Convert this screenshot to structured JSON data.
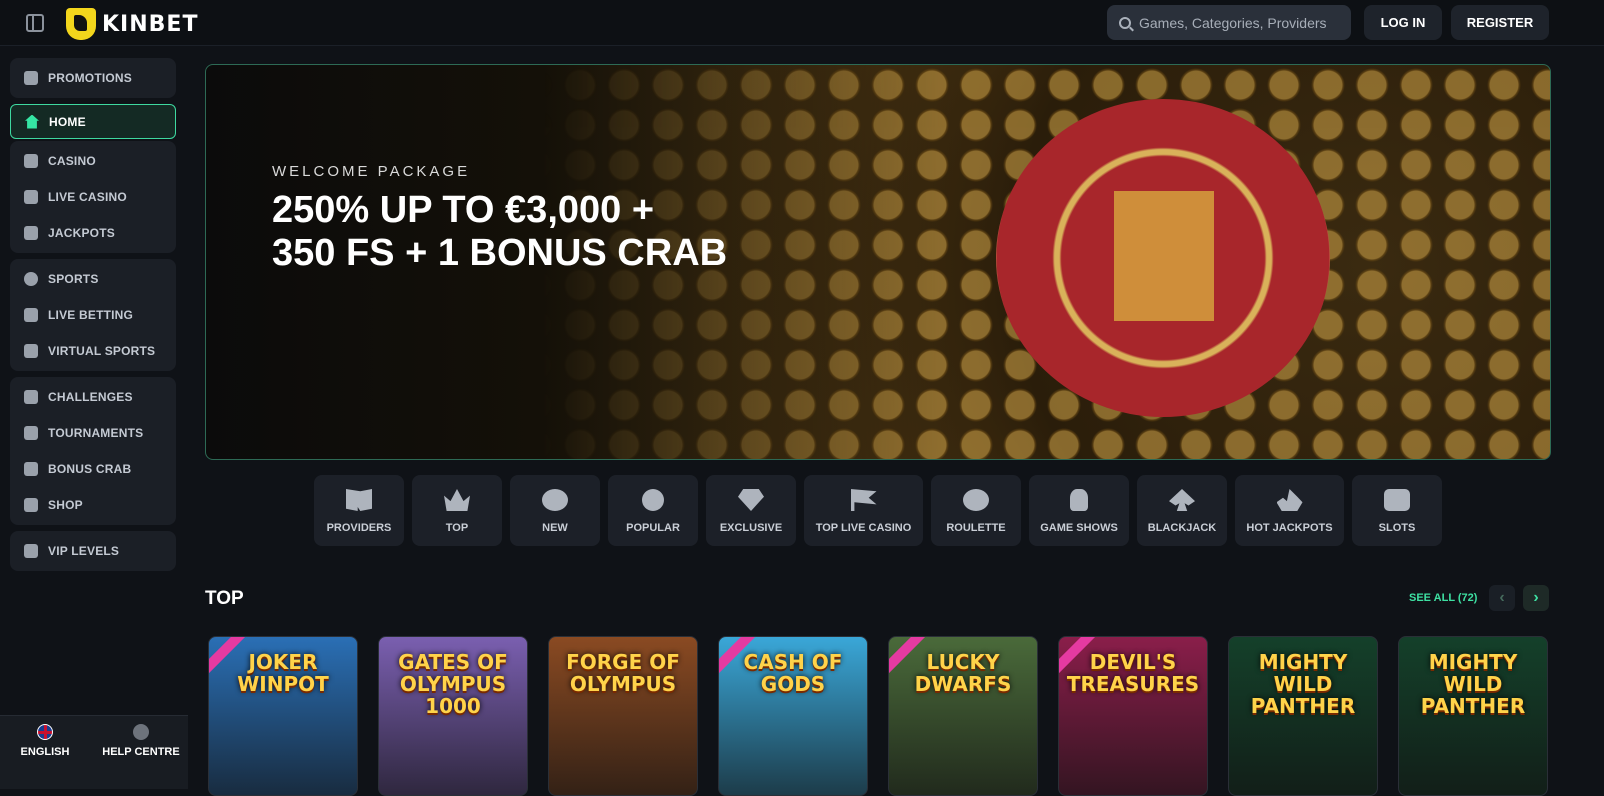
{
  "header": {
    "logo_text": "KINBET",
    "search_placeholder": "Games, Categories, Providers",
    "login_label": "LOG IN",
    "register_label": "REGISTER"
  },
  "sidebar": {
    "groups": [
      [
        {
          "label": "PROMOTIONS",
          "icon": "gift-icon"
        }
      ],
      [
        {
          "label": "HOME",
          "icon": "home-icon",
          "active": true
        }
      ],
      [
        {
          "label": "CASINO",
          "icon": "slot-icon"
        },
        {
          "label": "LIVE CASINO",
          "icon": "cards-icon"
        },
        {
          "label": "JACKPOTS",
          "icon": "clover-icon"
        }
      ],
      [
        {
          "label": "SPORTS",
          "icon": "ball-icon"
        },
        {
          "label": "LIVE BETTING",
          "icon": "live-icon"
        },
        {
          "label": "VIRTUAL SPORTS",
          "icon": "monitor-icon"
        }
      ],
      [
        {
          "label": "CHALLENGES",
          "icon": "badge-icon"
        },
        {
          "label": "TOURNAMENTS",
          "icon": "trophy-icon"
        },
        {
          "label": "BONUS CRAB",
          "icon": "crab-icon"
        },
        {
          "label": "SHOP",
          "icon": "shop-icon"
        }
      ],
      [
        {
          "label": "VIP LEVELS",
          "icon": "diamond-icon"
        }
      ]
    ],
    "language_label": "ENGLISH",
    "help_label": "HELP CENTRE"
  },
  "hero": {
    "kicker": "WELCOME PACKAGE",
    "title_line1": "250% UP TO €3,000 +",
    "title_line2": "350 FS + 1 BONUS CRAB"
  },
  "categories": [
    {
      "label": "PROVIDERS",
      "icon": "book-icon"
    },
    {
      "label": "TOP",
      "icon": "crown-icon"
    },
    {
      "label": "NEW",
      "icon": "clover-icon"
    },
    {
      "label": "POPULAR",
      "icon": "bomb-icon"
    },
    {
      "label": "EXCLUSIVE",
      "icon": "diamond-icon"
    },
    {
      "label": "TOP LIVE CASINO",
      "icon": "flag-icon"
    },
    {
      "label": "ROULETTE",
      "icon": "roulette-icon"
    },
    {
      "label": "GAME SHOWS",
      "icon": "microphone-icon"
    },
    {
      "label": "BLACKJACK",
      "icon": "spade-icon"
    },
    {
      "label": "HOT JACKPOTS",
      "icon": "fire-icon"
    },
    {
      "label": "SLOTS",
      "icon": "slots-icon"
    }
  ],
  "top_section": {
    "title": "TOP",
    "see_all": "SEE ALL (72)",
    "games": [
      {
        "title": "JOKER WINPOT",
        "bg": "#2a6fb5",
        "tag": true
      },
      {
        "title": "GATES OF OLYMPUS 1000",
        "bg": "#7a5fb0",
        "tag": false
      },
      {
        "title": "FORGE OF OLYMPUS",
        "bg": "#8a4a22",
        "tag": false
      },
      {
        "title": "CASH OF GODS",
        "bg": "#3aa7d8",
        "tag": true
      },
      {
        "title": "LUCKY DWARFS",
        "bg": "#4a6a3a",
        "tag": true
      },
      {
        "title": "DEVIL'S TREASURES",
        "bg": "#8a1e4a",
        "tag": true
      },
      {
        "title": "MIGHTY WILD PANTHER",
        "bg": "#14402a",
        "tag": false
      },
      {
        "title": "MIGHTY WILD PANTHER",
        "bg": "#14402a",
        "tag": false
      }
    ]
  },
  "colors": {
    "accent": "#3ee0a2",
    "brand_yellow": "#f3d61c",
    "background": "#0f1217"
  }
}
